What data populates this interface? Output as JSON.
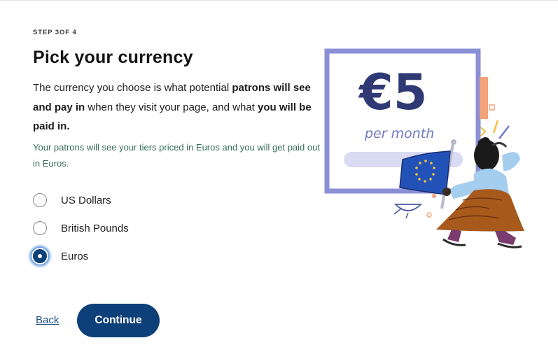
{
  "step": {
    "label": "STEP 3OF 4"
  },
  "header": {
    "title": "Pick your currency"
  },
  "description": {
    "part1": "The currency you choose is what potential ",
    "bold1": "patrons will see and pay in",
    "part2": " when they visit your page, and what ",
    "bold2": "you will be paid in."
  },
  "note": "Your patrons will see your tiers priced in Euros and you will get paid out in Euros.",
  "options": [
    {
      "label": "US Dollars",
      "selected": false
    },
    {
      "label": "British Pounds",
      "selected": false
    },
    {
      "label": "Euros",
      "selected": true
    }
  ],
  "actions": {
    "back_label": "Back",
    "continue_label": "Continue"
  },
  "illustration": {
    "price": "€5",
    "period": "per month"
  },
  "colors": {
    "primary": "#0d3f78",
    "note_text": "#356d5a",
    "card_frame": "#8a8fd6",
    "price_navy": "#2f3a74"
  }
}
